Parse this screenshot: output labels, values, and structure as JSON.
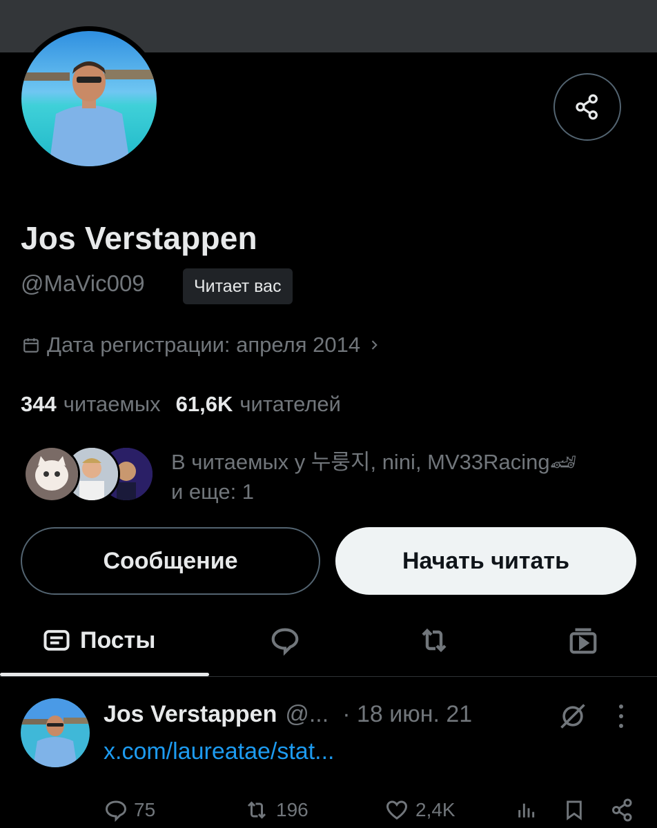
{
  "profile": {
    "name": "Jos Verstappen",
    "handle": "@MaVic009",
    "follows_you_badge": "Читает вас",
    "joined": "Дата регистрации: апреля 2014",
    "following_count": "344",
    "following_label": "читаемых",
    "followers_count": "61,6K",
    "followers_label": "читателей",
    "mutuals_line1": "В читаемых у 누룽지, nini, MV33Racing🏎",
    "mutuals_line2": "и еще: 1"
  },
  "buttons": {
    "message": "Сообщение",
    "follow": "Начать читать"
  },
  "tabs": {
    "posts": "Посты"
  },
  "post": {
    "name": "Jos Verstappen",
    "handle": "@...",
    "date": "· 18 июн. 21",
    "link_text": "x.com/laureatae/stat...",
    "replies": "75",
    "reposts": "196",
    "likes": "2,4K"
  },
  "colors": {
    "background": "#000000",
    "banner": "#333639",
    "text_primary": "#e7e9ea",
    "text_secondary": "#71767b",
    "link": "#1d9bf0"
  }
}
